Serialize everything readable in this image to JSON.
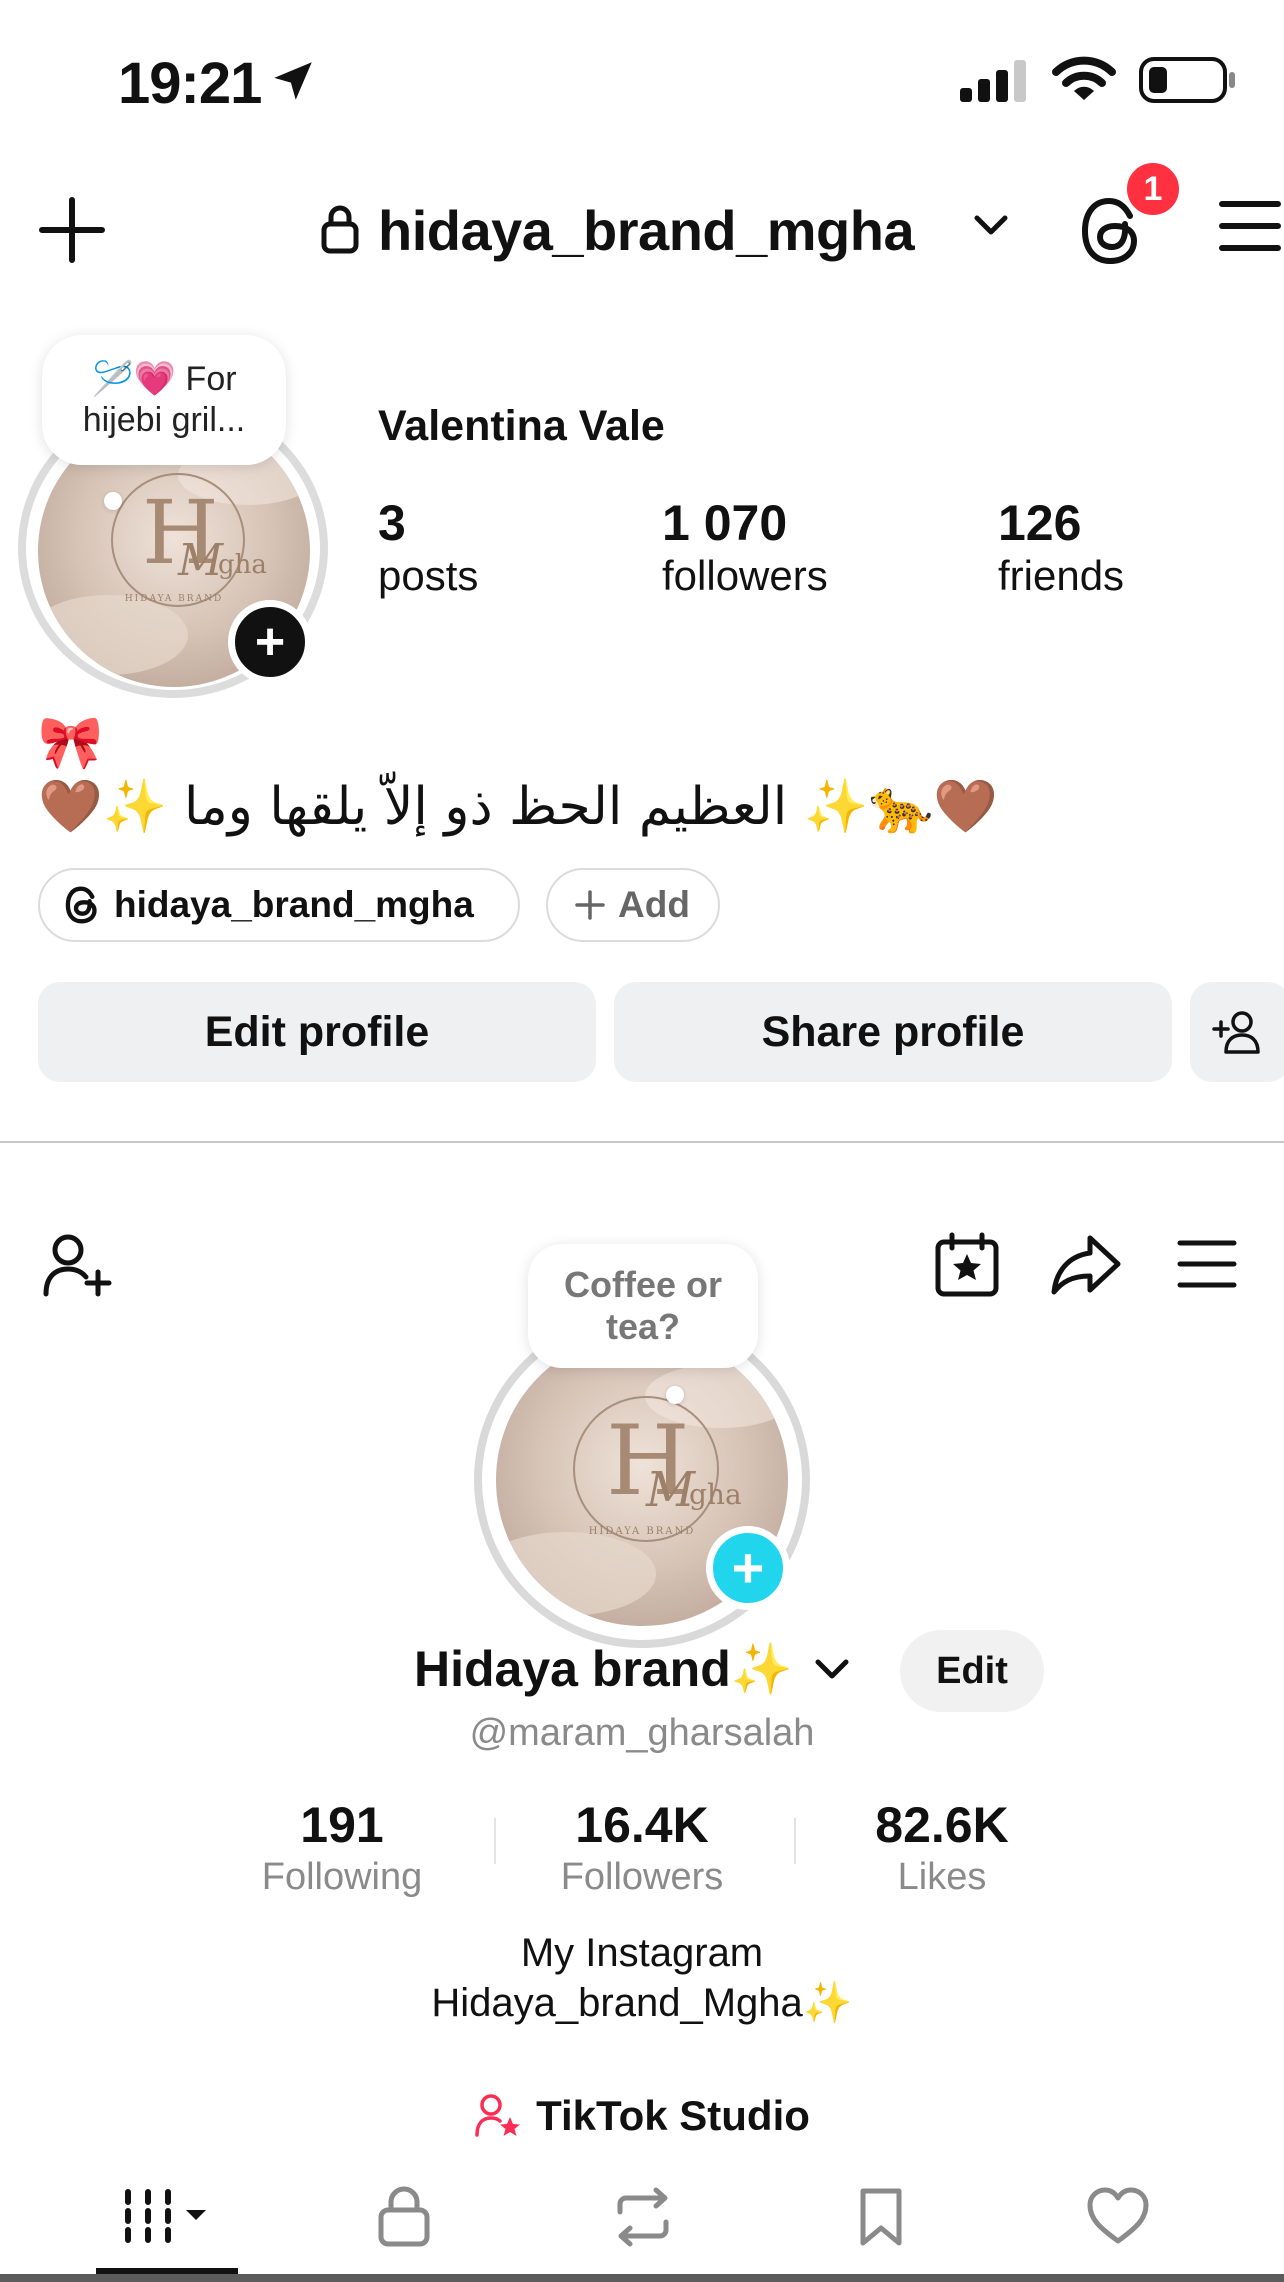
{
  "status_bar": {
    "time": "19:21"
  },
  "instagram": {
    "username": "hidaya_brand_mgha",
    "notification_count": "1",
    "note": "🪡💗 For hijebi gril...",
    "display_name": "Valentina Vale",
    "stats": [
      {
        "value": "3",
        "label": "posts"
      },
      {
        "value": "1 070",
        "label": "followers"
      },
      {
        "value": "126",
        "label": "friends"
      }
    ],
    "bio_line1": "🎀",
    "bio_line2": "🤎✨ العظيم الحظ ذو إلاّ يلقها وما ✨🐆🤎",
    "threads_pill": "hidaya_brand_mgha",
    "add_pill": "Add",
    "edit_profile": "Edit profile",
    "share_profile": "Share profile"
  },
  "tiktok": {
    "note": "Coffee or tea?",
    "name": "Hidaya brand✨",
    "edit": "Edit",
    "handle": "@maram_gharsalah",
    "stats": [
      {
        "value": "191",
        "label": "Following"
      },
      {
        "value": "16.4K",
        "label": "Followers"
      },
      {
        "value": "82.6K",
        "label": "Likes"
      }
    ],
    "bio_line1": "My Instagram",
    "bio_line2": "Hidaya_brand_Mgha✨",
    "studio": "TikTok Studio"
  },
  "icons": {
    "top": [
      "navigation-arrow-icon",
      "signal-icon",
      "wifi-icon",
      "battery-icon",
      "plus-icon",
      "lock-icon",
      "chevron-down-icon",
      "threads-icon",
      "menu-icon"
    ],
    "tiktok": [
      "add-user-icon",
      "calendar-star-icon",
      "share-icon",
      "menu-icon"
    ],
    "tabs": [
      "grid-icon",
      "lock-icon",
      "repost-icon",
      "bookmark-icon",
      "heart-icon"
    ]
  },
  "colors": {
    "badge": "#ff3040",
    "tiktok_accent": "#20d5ec",
    "studio_icon": "#fe2c55"
  }
}
